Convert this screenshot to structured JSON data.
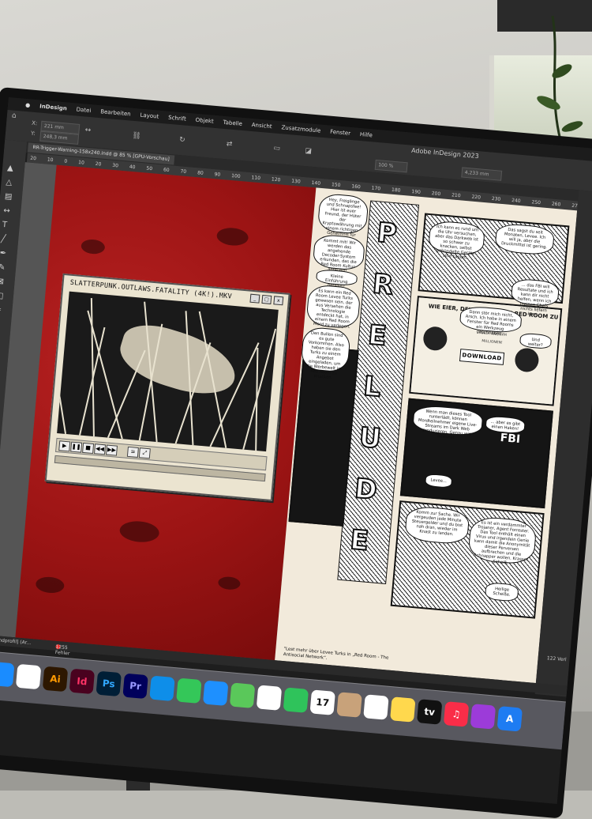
{
  "menubar": {
    "app_name": "InDesign",
    "items": [
      "Datei",
      "Bearbeiten",
      "Layout",
      "Schrift",
      "Objekt",
      "Tabelle",
      "Ansicht",
      "Zusatzmodule",
      "Fenster",
      "Hilfe"
    ]
  },
  "control": {
    "x_value": "221 mm",
    "y_value": "248,3 mm",
    "zoom_value": "100 %",
    "stroke_weight": "4,233 mm",
    "window_title": "Adobe InDesign 2023"
  },
  "document": {
    "tab_label": "RR-Trigger-Warning-158x240.indd @ 85 % [GPU-Vorschau]"
  },
  "ruler": {
    "ticks": [
      "20",
      "10",
      "0",
      "10",
      "20",
      "30",
      "40",
      "50",
      "60",
      "70",
      "80",
      "90",
      "100",
      "110",
      "120",
      "130",
      "140",
      "150",
      "160",
      "170",
      "180",
      "190",
      "200",
      "210",
      "220",
      "230",
      "240",
      "250",
      "260",
      "270",
      "280",
      "290"
    ]
  },
  "player": {
    "title": "SLATTERPUNK.OUTLAWS.FATALITY (4K!).MKV",
    "buttons": {
      "minimize": "_",
      "maximize": "□",
      "close": "x"
    }
  },
  "comic": {
    "vertical_title": [
      "P",
      "R",
      "E",
      "L",
      "U",
      "D",
      "E"
    ],
    "bubbles": {
      "b1": "Hey, Freigänge und Schnapsfee! Hier ist euer Freund, der Hüter der Kryptowährung mit einem richtigen Geheimnis für euch!",
      "b2": "Kommt mit! Wir werden das angehende Decoder-System erkunden, das die Red Room Kultur anfeuert!",
      "b3": "Kleine Einführung gefällig?",
      "b4": "Es kann ein Red Room Levee Turks gewesen sein, der aus Versehen die Technologie entdeckt hat, in einem Red Room Mord zu verlegen.",
      "b5": "Den Bullen sind es gute Vorkommen. Also haben sie den Turks zu einem Angebot eingeladen, um die Werbewelt im Red Room zu knacken.",
      "b6": "Ich kann es rund um die Uhr versuchen, aber das Darkweb ist so schwer zu knacken, selbst gebündelte Geräte sind kaputt.",
      "b7": "Das sagst du seit Monaten, Levee. Ich will ja, aber die Druckmittel ist gering.",
      "b8": "... das FBI will Resultate und ich kann dir nicht helfen, wenn ich meinen Chefs nichts liefern kann.",
      "b9": "Dann stör mich nicht, Arsch. Ich habe in einem Fenster für Red Rooms ein Werkzeug geschrieben.",
      "b10": "Und weiter?",
      "b11": "Wenn man dieses Tool runterlädt, können Mordteilnehmer eigene Live-Streams im Dark Web produzieren. Genau wie bewusst.",
      "b12": "... aber es gibt einen Haken!",
      "b13": "Levee...",
      "b14": "Komm zur Sache. Wir vergeuden jede Minute Steuergelder und du bist nah dran, wieder im Knast zu landen.",
      "b15": "Es ist ein verdammter Trojaner, Agent Forrester. Das Tool enthält einen Virus und irgendein Genie kann damit die Anonymität dieser Perversen aufbrechen und die Schnapper wollen. Krasser Scheiß.",
      "b16": "Heilige Scheiße."
    },
    "stream": {
      "title": "WIE EIER, DEINEN EIGENEN RED ROOM ZU STREAMEN?",
      "sub1": "MACH ANONYM",
      "sub2": "MILLIONEN!",
      "button": "DOWNLOAD"
    },
    "fbi_text": "FBI",
    "caption": "\"Lest mehr über Levee Turks in „Red Room - The Antisocial Network“."
  },
  "statusbar": {
    "profile": "[Grundprofil] (Ar...",
    "errors": "1255 Fehler"
  },
  "rightpanel": {
    "label": "122 Verl"
  },
  "dock": {
    "items": [
      {
        "name": "launchpad-icon",
        "label": "",
        "bg": "#dadada",
        "fg": "#555"
      },
      {
        "name": "safari-icon",
        "label": "",
        "bg": "#1a8cff",
        "fg": "#fff"
      },
      {
        "name": "chrome-icon",
        "label": "",
        "bg": "#ffffff",
        "fg": "#333"
      },
      {
        "name": "illustrator-icon",
        "label": "Ai",
        "bg": "#2d1700",
        "fg": "#ff9a00"
      },
      {
        "name": "indesign-icon",
        "label": "Id",
        "bg": "#49021f",
        "fg": "#ff3366"
      },
      {
        "name": "photoshop-icon",
        "label": "Ps",
        "bg": "#001e36",
        "fg": "#31a8ff"
      },
      {
        "name": "premiere-icon",
        "label": "Pr",
        "bg": "#00005b",
        "fg": "#9999ff"
      },
      {
        "name": "teamviewer-icon",
        "label": "",
        "bg": "#0e8ee9",
        "fg": "#fff"
      },
      {
        "name": "messages-icon",
        "label": "",
        "bg": "#34c759",
        "fg": "#fff"
      },
      {
        "name": "mail-icon",
        "label": "",
        "bg": "#1e90ff",
        "fg": "#fff"
      },
      {
        "name": "maps-icon",
        "label": "",
        "bg": "#5ac85a",
        "fg": "#fff"
      },
      {
        "name": "photos-icon",
        "label": "",
        "bg": "#ffffff",
        "fg": "#e44"
      },
      {
        "name": "facetime-icon",
        "label": "",
        "bg": "#2fc35b",
        "fg": "#fff"
      },
      {
        "name": "calendar-icon",
        "label": "17",
        "bg": "#ffffff",
        "fg": "#111"
      },
      {
        "name": "contacts-icon",
        "label": "",
        "bg": "#c8a27a",
        "fg": "#fff"
      },
      {
        "name": "reminders-icon",
        "label": "",
        "bg": "#ffffff",
        "fg": "#333"
      },
      {
        "name": "notes-icon",
        "label": "",
        "bg": "#ffd84d",
        "fg": "#333"
      },
      {
        "name": "appletv-icon",
        "label": "tv",
        "bg": "#111111",
        "fg": "#fff"
      },
      {
        "name": "music-icon",
        "label": "♫",
        "bg": "#fa2d48",
        "fg": "#fff"
      },
      {
        "name": "podcasts-icon",
        "label": "",
        "bg": "#9c3bd9",
        "fg": "#fff"
      },
      {
        "name": "appstore-icon",
        "label": "A",
        "bg": "#1e7cf2",
        "fg": "#fff"
      }
    ]
  }
}
